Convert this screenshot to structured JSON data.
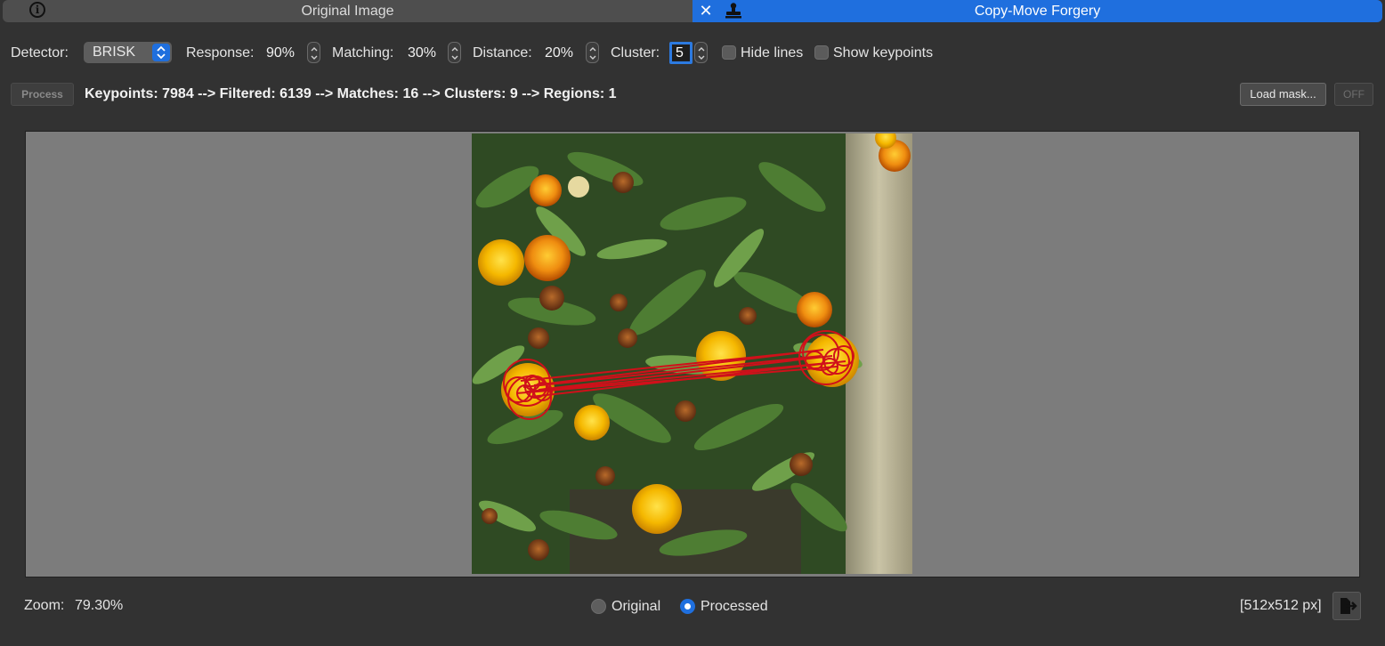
{
  "tabs": {
    "left_title": "Original Image",
    "right_title": "Copy-Move Forgery",
    "left_icon": "info-icon",
    "right_icons": [
      "close-icon",
      "stamp-icon"
    ],
    "active_color": "#1f6fde"
  },
  "toolbar": {
    "detector_label": "Detector:",
    "detector_value": "BRISK",
    "response_label": "Response:",
    "response_value": "90%",
    "matching_label": "Matching:",
    "matching_value": "30%",
    "distance_label": "Distance:",
    "distance_value": "20%",
    "cluster_label": "Cluster:",
    "cluster_value": "5",
    "hide_lines_label": "Hide lines",
    "hide_lines_checked": false,
    "show_keypoints_label": "Show keypoints",
    "show_keypoints_checked": false
  },
  "actions": {
    "process_label": "Process",
    "status_text": "Keypoints: 7984 --> Filtered: 6139 --> Matches: 16 --> Clusters: 9 --> Regions: 1",
    "load_mask_label": "Load mask...",
    "off_label": "OFF"
  },
  "footer": {
    "zoom_label": "Zoom:",
    "zoom_value": "79.30%",
    "view_options": [
      "Original",
      "Processed"
    ],
    "selected_view": "Processed",
    "image_size": "[512x512 px]",
    "export_icon": "export-icon"
  }
}
